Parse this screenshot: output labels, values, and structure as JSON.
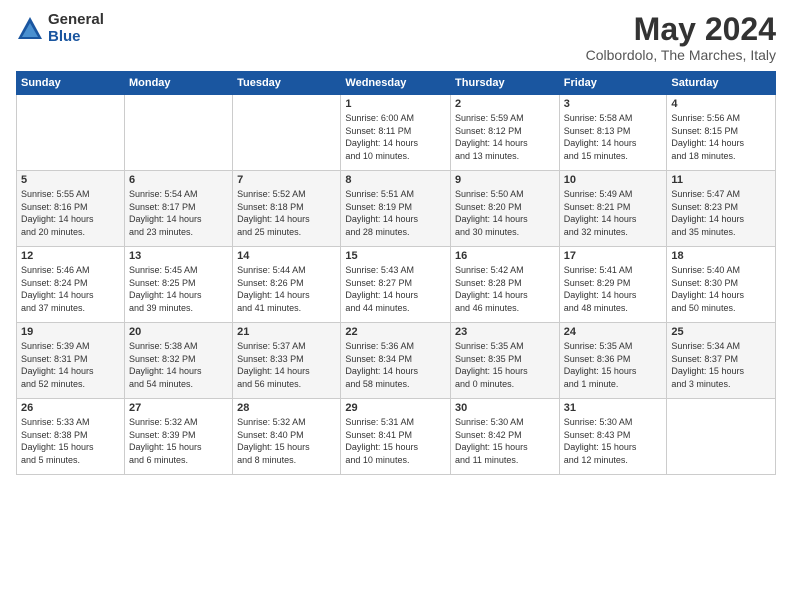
{
  "logo": {
    "general": "General",
    "blue": "Blue"
  },
  "title": "May 2024",
  "subtitle": "Colbordolo, The Marches, Italy",
  "headers": [
    "Sunday",
    "Monday",
    "Tuesday",
    "Wednesday",
    "Thursday",
    "Friday",
    "Saturday"
  ],
  "weeks": [
    [
      {
        "day": "",
        "info": ""
      },
      {
        "day": "",
        "info": ""
      },
      {
        "day": "",
        "info": ""
      },
      {
        "day": "1",
        "info": "Sunrise: 6:00 AM\nSunset: 8:11 PM\nDaylight: 14 hours\nand 10 minutes."
      },
      {
        "day": "2",
        "info": "Sunrise: 5:59 AM\nSunset: 8:12 PM\nDaylight: 14 hours\nand 13 minutes."
      },
      {
        "day": "3",
        "info": "Sunrise: 5:58 AM\nSunset: 8:13 PM\nDaylight: 14 hours\nand 15 minutes."
      },
      {
        "day": "4",
        "info": "Sunrise: 5:56 AM\nSunset: 8:15 PM\nDaylight: 14 hours\nand 18 minutes."
      }
    ],
    [
      {
        "day": "5",
        "info": "Sunrise: 5:55 AM\nSunset: 8:16 PM\nDaylight: 14 hours\nand 20 minutes."
      },
      {
        "day": "6",
        "info": "Sunrise: 5:54 AM\nSunset: 8:17 PM\nDaylight: 14 hours\nand 23 minutes."
      },
      {
        "day": "7",
        "info": "Sunrise: 5:52 AM\nSunset: 8:18 PM\nDaylight: 14 hours\nand 25 minutes."
      },
      {
        "day": "8",
        "info": "Sunrise: 5:51 AM\nSunset: 8:19 PM\nDaylight: 14 hours\nand 28 minutes."
      },
      {
        "day": "9",
        "info": "Sunrise: 5:50 AM\nSunset: 8:20 PM\nDaylight: 14 hours\nand 30 minutes."
      },
      {
        "day": "10",
        "info": "Sunrise: 5:49 AM\nSunset: 8:21 PM\nDaylight: 14 hours\nand 32 minutes."
      },
      {
        "day": "11",
        "info": "Sunrise: 5:47 AM\nSunset: 8:23 PM\nDaylight: 14 hours\nand 35 minutes."
      }
    ],
    [
      {
        "day": "12",
        "info": "Sunrise: 5:46 AM\nSunset: 8:24 PM\nDaylight: 14 hours\nand 37 minutes."
      },
      {
        "day": "13",
        "info": "Sunrise: 5:45 AM\nSunset: 8:25 PM\nDaylight: 14 hours\nand 39 minutes."
      },
      {
        "day": "14",
        "info": "Sunrise: 5:44 AM\nSunset: 8:26 PM\nDaylight: 14 hours\nand 41 minutes."
      },
      {
        "day": "15",
        "info": "Sunrise: 5:43 AM\nSunset: 8:27 PM\nDaylight: 14 hours\nand 44 minutes."
      },
      {
        "day": "16",
        "info": "Sunrise: 5:42 AM\nSunset: 8:28 PM\nDaylight: 14 hours\nand 46 minutes."
      },
      {
        "day": "17",
        "info": "Sunrise: 5:41 AM\nSunset: 8:29 PM\nDaylight: 14 hours\nand 48 minutes."
      },
      {
        "day": "18",
        "info": "Sunrise: 5:40 AM\nSunset: 8:30 PM\nDaylight: 14 hours\nand 50 minutes."
      }
    ],
    [
      {
        "day": "19",
        "info": "Sunrise: 5:39 AM\nSunset: 8:31 PM\nDaylight: 14 hours\nand 52 minutes."
      },
      {
        "day": "20",
        "info": "Sunrise: 5:38 AM\nSunset: 8:32 PM\nDaylight: 14 hours\nand 54 minutes."
      },
      {
        "day": "21",
        "info": "Sunrise: 5:37 AM\nSunset: 8:33 PM\nDaylight: 14 hours\nand 56 minutes."
      },
      {
        "day": "22",
        "info": "Sunrise: 5:36 AM\nSunset: 8:34 PM\nDaylight: 14 hours\nand 58 minutes."
      },
      {
        "day": "23",
        "info": "Sunrise: 5:35 AM\nSunset: 8:35 PM\nDaylight: 15 hours\nand 0 minutes."
      },
      {
        "day": "24",
        "info": "Sunrise: 5:35 AM\nSunset: 8:36 PM\nDaylight: 15 hours\nand 1 minute."
      },
      {
        "day": "25",
        "info": "Sunrise: 5:34 AM\nSunset: 8:37 PM\nDaylight: 15 hours\nand 3 minutes."
      }
    ],
    [
      {
        "day": "26",
        "info": "Sunrise: 5:33 AM\nSunset: 8:38 PM\nDaylight: 15 hours\nand 5 minutes."
      },
      {
        "day": "27",
        "info": "Sunrise: 5:32 AM\nSunset: 8:39 PM\nDaylight: 15 hours\nand 6 minutes."
      },
      {
        "day": "28",
        "info": "Sunrise: 5:32 AM\nSunset: 8:40 PM\nDaylight: 15 hours\nand 8 minutes."
      },
      {
        "day": "29",
        "info": "Sunrise: 5:31 AM\nSunset: 8:41 PM\nDaylight: 15 hours\nand 10 minutes."
      },
      {
        "day": "30",
        "info": "Sunrise: 5:30 AM\nSunset: 8:42 PM\nDaylight: 15 hours\nand 11 minutes."
      },
      {
        "day": "31",
        "info": "Sunrise: 5:30 AM\nSunset: 8:43 PM\nDaylight: 15 hours\nand 12 minutes."
      },
      {
        "day": "",
        "info": ""
      }
    ]
  ]
}
